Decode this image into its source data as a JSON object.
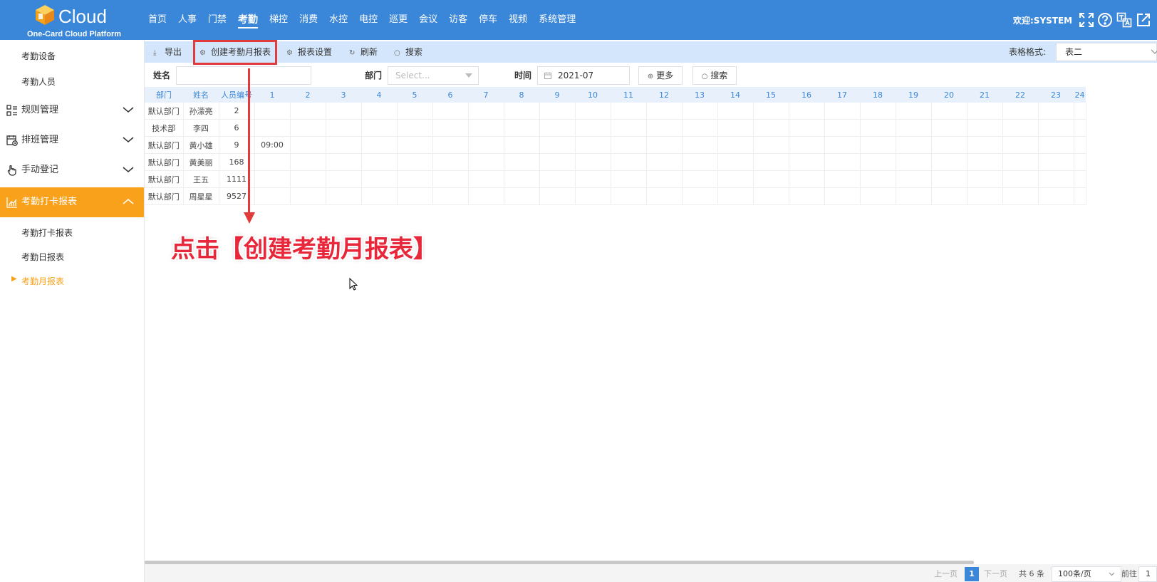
{
  "header": {
    "logo_text": "Cloud",
    "logo_sub": "One-Card Cloud Platform",
    "nav": [
      "首页",
      "人事",
      "门禁",
      "考勤",
      "梯控",
      "消费",
      "水控",
      "电控",
      "巡更",
      "会议",
      "访客",
      "停车",
      "视频",
      "系统管理"
    ],
    "nav_active": "考勤",
    "welcome": "欢迎:SYSTEM",
    "icons": [
      "fullscreen-icon",
      "help-icon",
      "translate-icon",
      "external-link-icon"
    ]
  },
  "sidebar": {
    "top_items": [
      "考勤设备",
      "考勤人员"
    ],
    "groups": [
      {
        "label": "规则管理",
        "icon": "rules-icon"
      },
      {
        "label": "排班管理",
        "icon": "schedule-icon"
      },
      {
        "label": "手动登记",
        "icon": "hand-icon"
      },
      {
        "label": "考勤打卡报表",
        "icon": "chart-icon"
      }
    ],
    "report_items": [
      "考勤打卡报表",
      "考勤日报表",
      "考勤月报表"
    ],
    "current_item": "考勤月报表"
  },
  "toolbar": {
    "export": "导出",
    "create_monthly": "创建考勤月报表",
    "report_settings": "报表设置",
    "refresh": "刷新",
    "search": "搜索",
    "format_label": "表格格式:",
    "format_value": "表二"
  },
  "filters": {
    "name_label": "姓名",
    "name_value": "",
    "dept_label": "部门",
    "dept_placeholder": "Select...",
    "time_label": "时间",
    "time_value": "2021-07",
    "more": "更多",
    "search": "搜索"
  },
  "table": {
    "headers": [
      "部门",
      "姓名",
      "人员编号",
      "1",
      "2",
      "3",
      "4",
      "5",
      "6",
      "7",
      "8",
      "9",
      "10",
      "11",
      "12",
      "13",
      "14",
      "15",
      "16",
      "17",
      "18",
      "19",
      "20",
      "21",
      "22",
      "23",
      "24"
    ],
    "rows": [
      {
        "dept": "默认部门",
        "name": "孙濛亮",
        "id": "2",
        "day1": ""
      },
      {
        "dept": "技术部",
        "name": "李四",
        "id": "6",
        "day1": ""
      },
      {
        "dept": "默认部门",
        "name": "黄小雄",
        "id": "9",
        "day1": "09:00"
      },
      {
        "dept": "默认部门",
        "name": "黄美丽",
        "id": "168",
        "day1": ""
      },
      {
        "dept": "默认部门",
        "name": "王五",
        "id": "1111",
        "day1": ""
      },
      {
        "dept": "默认部门",
        "name": "周星星",
        "id": "9527",
        "day1": ""
      }
    ]
  },
  "annotation": {
    "text": "点击【创建考勤月报表】",
    "color": "#e8283a"
  },
  "pagination": {
    "prev": "上一页",
    "current_page": "1",
    "next": "下一页",
    "total": "共 6 条",
    "page_size": "100条/页",
    "goto_label": "前往",
    "goto_value": "1"
  },
  "colors": {
    "primary": "#3a86d8",
    "accent": "#f9a11b",
    "annotation": "#e23b3b",
    "toolbar_bg": "#d4e6fb"
  }
}
